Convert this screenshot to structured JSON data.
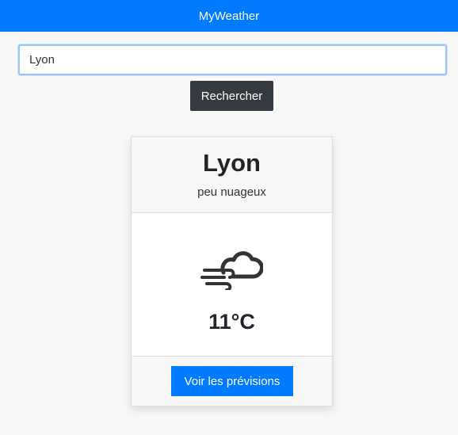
{
  "app": {
    "title": "MyWeather"
  },
  "search": {
    "value": "Lyon",
    "button_label": "Rechercher"
  },
  "weather_card": {
    "city": "Lyon",
    "description": "peu nuageux",
    "icon": "cloud-wind-icon",
    "temperature": "11°C",
    "forecast_button_label": "Voir les prévisions"
  },
  "colors": {
    "header": "#007bff",
    "search_button": "#343a40",
    "forecast_button": "#007bff"
  }
}
